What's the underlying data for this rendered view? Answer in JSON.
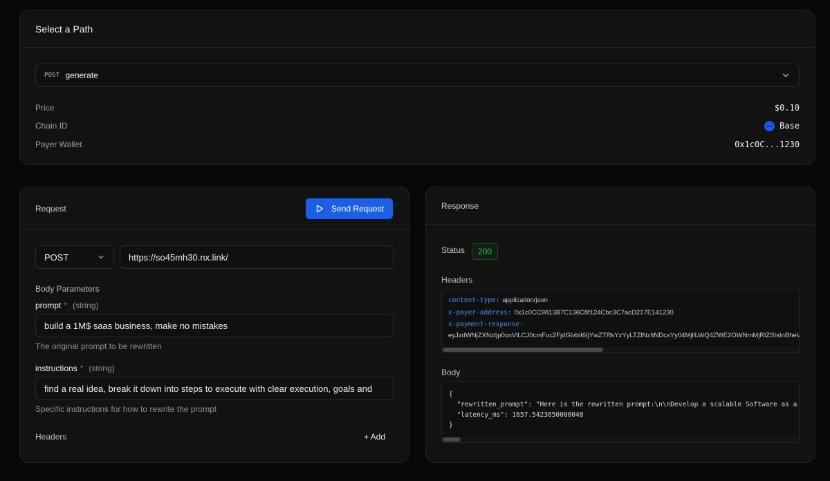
{
  "path_card": {
    "title": "Select a Path",
    "selected": {
      "method": "POST",
      "path": "generate"
    },
    "rows": [
      {
        "label": "Price",
        "value": "$0.10"
      },
      {
        "label": "Chain ID",
        "value": "Base"
      },
      {
        "label": "Payer Wallet",
        "value": "0x1c0C...1230"
      }
    ]
  },
  "request": {
    "title": "Request",
    "send_label": "Send Request",
    "method": "POST",
    "url": "https://so45mh30.nx.link/",
    "body_params_label": "Body Parameters",
    "params": [
      {
        "name": "prompt",
        "required_mark": "*",
        "type": "(string)",
        "value": "build a 1M$ saas business, make no mistakes",
        "help": "The original prompt to be rewritten"
      },
      {
        "name": "instructions",
        "required_mark": "*",
        "type": "(string)",
        "value": "find a real idea, break it down into steps to execute with clear execution, goals and",
        "help": "Specific instructions for how to rewrite the prompt"
      }
    ],
    "headers_label": "Headers",
    "add_label": "+ Add"
  },
  "response": {
    "title": "Response",
    "status_label": "Status",
    "status_code": "200",
    "headers_label": "Headers",
    "headers": [
      {
        "key": "content-type:",
        "value": "application/json"
      },
      {
        "key": "x-payer-address:",
        "value": "0x1c0CC9813B7C136C8f124Cbc3C7acD217E141230"
      },
      {
        "key": "x-payment-response:",
        "value": ""
      },
      {
        "key": "",
        "value": "eyJzdWNjZXNzIjp0cnVlLCJ0cmFuc2FjdGlvbiI6IjYwZTRkYzYyLTZlNzItNDcxYy04MjllLWQ4ZWE2OWNmMjRlZSIsInBheWVyIjoiMHgxYzBDQzk4MTNCN0MxMzZDOGYxMjRDYmMzQzdhY0QyMTdFMTQxMjMwIn0"
      }
    ],
    "headers_scroll_fraction": 0.45,
    "body_label": "Body",
    "body_lines": [
      "{",
      "  \"rewritten_prompt\": \"Here is the rewritten prompt:\\n\\nDevelop a scalable Software as a Service (SaaS) business",
      "  \"latency_ms\": 1657.5423650000048",
      "}"
    ],
    "body_scroll_fraction": 0.05
  },
  "colors": {
    "accent": "#1c5ee4",
    "status_ok": "#3fbf5f",
    "required": "#e5484d",
    "header_key": "#3f8ef0"
  }
}
